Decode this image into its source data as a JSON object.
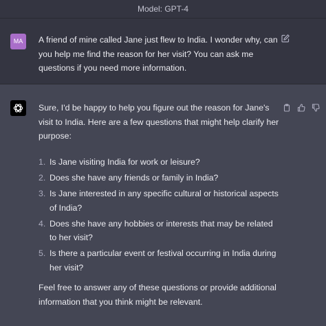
{
  "header": {
    "model_label": "Model: GPT-4"
  },
  "user_message": {
    "avatar_initials": "MA",
    "text": "A friend of mine called Jane just flew to India. I wonder why, can you help me find the reason for her visit? You can ask me questions if you need more information."
  },
  "assistant_message": {
    "intro": "Sure, I'd be happy to help you figure out the reason for Jane's visit to India. Here are a few questions that might help clarify her purpose:",
    "questions": [
      {
        "num": "1.",
        "text": "Is Jane visiting India for work or leisure?"
      },
      {
        "num": "2.",
        "text": "Does she have any friends or family in India?"
      },
      {
        "num": "3.",
        "text": "Is Jane interested in any specific cultural or historical aspects of India?"
      },
      {
        "num": "4.",
        "text": "Does she have any hobbies or interests that may be related to her visit?"
      },
      {
        "num": "5.",
        "text": "Is there a particular event or festival occurring in India during her visit?"
      }
    ],
    "outro": "Feel free to answer any of these questions or provide additional information that you think might be relevant."
  },
  "colors": {
    "user_bg": "#343541",
    "assistant_bg": "#444654",
    "user_avatar": "#a96ec9",
    "text": "#ececf1"
  },
  "icons": [
    "edit-icon",
    "copy-icon",
    "thumbs-up-icon",
    "thumbs-down-icon",
    "openai-logo-icon"
  ]
}
